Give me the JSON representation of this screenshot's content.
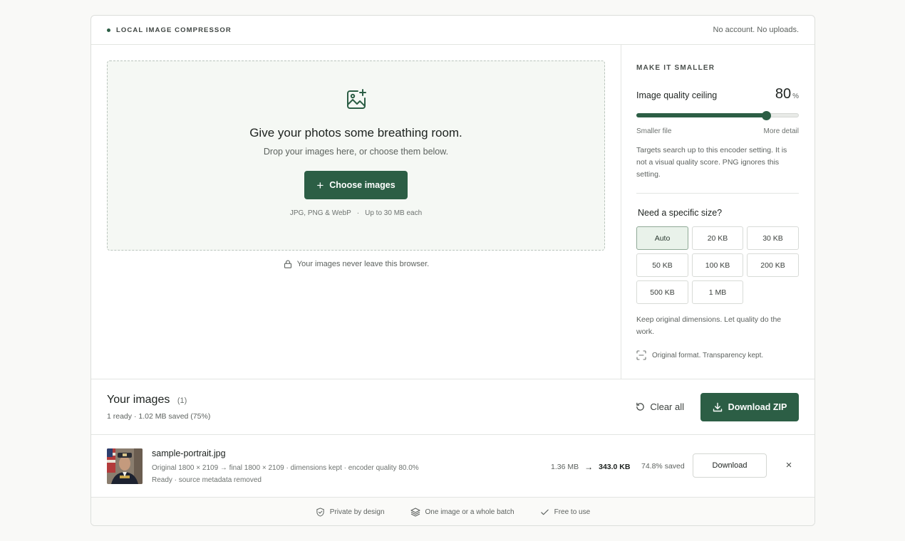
{
  "header": {
    "brand": "LOCAL IMAGE COMPRESSOR",
    "tagline": "No account. No uploads."
  },
  "dropzone": {
    "title": "Give your photos some breathing room.",
    "subtitle": "Drop your images here, or choose them below.",
    "button_label": "Choose images",
    "formats": "JPG, PNG & WebP",
    "separator": "·",
    "limit": "Up to 30 MB each",
    "privacy_note": "Your images never leave this browser."
  },
  "settings": {
    "section_label": "MAKE IT SMALLER",
    "quality_label": "Image quality ceiling",
    "quality_value": "80",
    "quality_unit": "%",
    "quality_fraction": 0.8,
    "slider_min_label": "Smaller file",
    "slider_max_label": "More detail",
    "help_text": "Targets search up to this encoder setting. It is not a visual quality score. PNG ignores this setting.",
    "size_title": "Need a specific size?",
    "size_options": [
      "Auto",
      "20 KB",
      "30 KB",
      "50 KB",
      "100 KB",
      "200 KB",
      "500 KB",
      "1 MB"
    ],
    "size_selected": "Auto",
    "keep_text": "Keep original dimensions. Let quality do the work.",
    "format_note": "Original format. Transparency kept."
  },
  "images": {
    "title": "Your images",
    "count": "(1)",
    "summary": "1 ready · 1.02 MB saved (75%)",
    "clear_label": "Clear all",
    "zip_label": "Download ZIP",
    "files": [
      {
        "name": "sample-portrait.jpg",
        "meta": "Original 1800 × 2109 → final 1800 × 2109 · dimensions kept · encoder quality 80.0%",
        "status": "Ready · source metadata removed",
        "original_size": "1.36 MB",
        "arrow": "→",
        "final_size": "343.0 KB",
        "saved": "74.8% saved",
        "download_label": "Download",
        "remove_symbol": "×"
      }
    ]
  },
  "footer": {
    "features": [
      "Private by design",
      "One image or a whole batch",
      "Free to use"
    ]
  },
  "colors": {
    "accent": "#2c5e45",
    "selected_bg": "#e9f2ea"
  },
  "icons": {
    "dropzone": "image-plus-icon",
    "lock": "lock-icon",
    "format": "scan-icon",
    "clear": "refresh-icon",
    "zip": "download-icon",
    "footer": [
      "shield-check-icon",
      "layers-icon",
      "check-icon"
    ]
  }
}
